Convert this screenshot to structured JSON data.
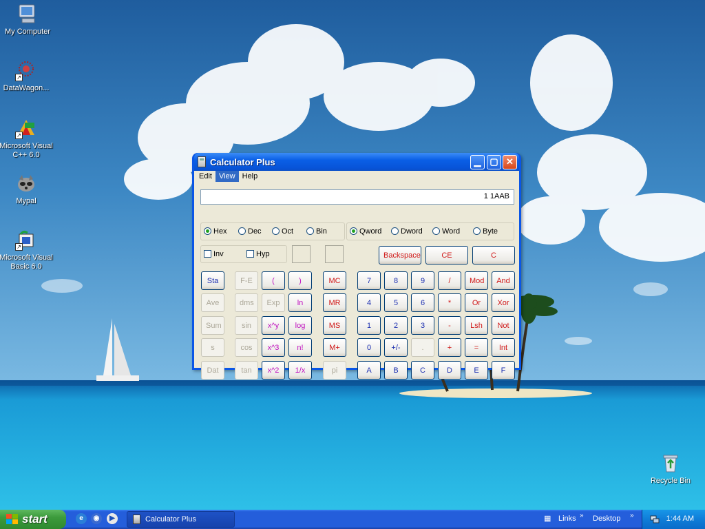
{
  "desktop": {
    "icons": [
      {
        "label": "My Computer"
      },
      {
        "label": "DataWagon..."
      },
      {
        "label": "Microsoft Visual C++ 6.0"
      },
      {
        "label": "Mypal"
      },
      {
        "label": "Microsoft Visual Basic 6.0"
      },
      {
        "label": "Recycle Bin"
      }
    ]
  },
  "window": {
    "title": "Calculator Plus",
    "menu": [
      "Edit",
      "View",
      "Help"
    ],
    "active_menu": "View",
    "display_value": "1 1AAB",
    "base_options": [
      "Hex",
      "Dec",
      "Oct",
      "Bin"
    ],
    "base_selected": "Hex",
    "word_options": [
      "Qword",
      "Dword",
      "Word",
      "Byte"
    ],
    "word_selected": "Qword",
    "checkboxes": [
      "Inv",
      "Hyp"
    ],
    "edit_buttons": [
      "Backspace",
      "CE",
      "C"
    ],
    "sci_buttons": [
      [
        "Sta",
        "F-E",
        "(",
        ")"
      ],
      [
        "Ave",
        "dms",
        "Exp",
        "ln"
      ],
      [
        "Sum",
        "sin",
        "x^y",
        "log"
      ],
      [
        "s",
        "cos",
        "x^3",
        "n!"
      ],
      [
        "Dat",
        "tan",
        "x^2",
        "1/x"
      ]
    ],
    "memory_buttons": [
      "MC",
      "MR",
      "MS",
      "M+",
      "pi"
    ],
    "num_buttons": [
      [
        "7",
        "8",
        "9",
        "/",
        "Mod",
        "And"
      ],
      [
        "4",
        "5",
        "6",
        "*",
        "Or",
        "Xor"
      ],
      [
        "1",
        "2",
        "3",
        "-",
        "Lsh",
        "Not"
      ],
      [
        "0",
        "+/-",
        ".",
        "+",
        "=",
        "Int"
      ],
      [
        "A",
        "B",
        "C",
        "D",
        "E",
        "F"
      ]
    ]
  },
  "taskbar": {
    "start_label": "start",
    "task_label": "Calculator Plus",
    "links_label": "Links",
    "desktop_label": "Desktop",
    "clock": "1:44 AM"
  }
}
